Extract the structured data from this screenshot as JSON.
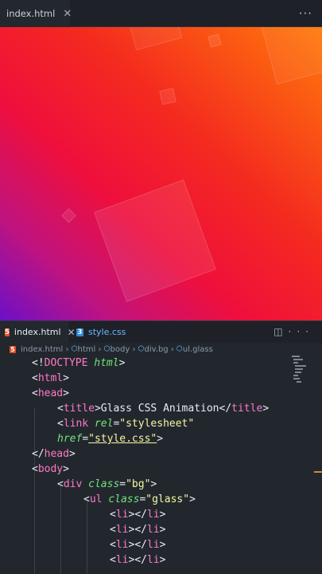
{
  "preview_tab": {
    "label": "index.html"
  },
  "editor_tabs": [
    {
      "label": "index.html",
      "icon": "html-file-icon"
    },
    {
      "label": "style.css",
      "icon": "css-file-icon"
    }
  ],
  "breadcrumb": [
    "index.html",
    "html",
    "body",
    "div.bg",
    "ul.glass"
  ],
  "preview_colors": {
    "purple": "#6c10c7",
    "red": "#ef0f3c",
    "orange": "#ff7a0a"
  },
  "code": {
    "l1": {
      "open": "<!",
      "name": "DOCTYPE",
      "attr": "html",
      "close": ">"
    },
    "l2": {
      "open": "<",
      "name": "html",
      "close": ">"
    },
    "l3": {
      "open": "<",
      "name": "head",
      "close": ">"
    },
    "l4": {
      "open1": "<",
      "name1": "title",
      "close1": ">",
      "text": "Glass CSS Animation",
      "open2": "</",
      "name2": "title",
      "close2": ">"
    },
    "l5": {
      "open": "<",
      "name": "link",
      "attr": "rel",
      "eq": "=",
      "value": "\"stylesheet\""
    },
    "l6": {
      "attr": "href",
      "eq": "=",
      "value": "\"style.css\"",
      "close": ">"
    },
    "l7": {
      "open": "</",
      "name": "head",
      "close": ">"
    },
    "l8": {
      "open": "<",
      "name": "body",
      "close": ">"
    },
    "l9": {
      "open": "<",
      "name": "div",
      "attr": "class",
      "eq": "=",
      "value": "\"bg\"",
      "close": ">"
    },
    "l10": {
      "open": "<",
      "name": "ul",
      "attr": "class",
      "eq": "=",
      "value": "\"glass\"",
      "close": ">"
    },
    "li": {
      "open1": "<",
      "name1": "li",
      "close1": ">",
      "open2": "</",
      "name2": "li",
      "close2": ">"
    }
  }
}
